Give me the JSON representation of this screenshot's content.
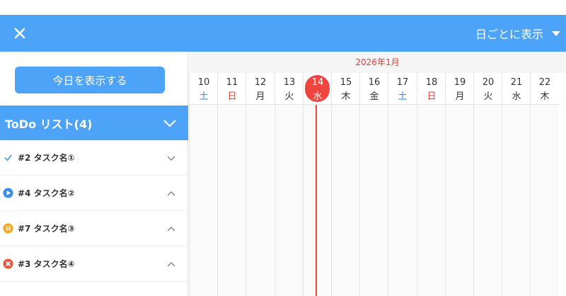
{
  "header": {
    "view_mode": "日ごとに表示"
  },
  "sidebar": {
    "today_button": "今日を表示する",
    "todo_title": "ToDo リスト(4)",
    "items": [
      {
        "name": "#2 タスク名①",
        "status": "check-icon",
        "expanded": false
      },
      {
        "name": "#4 タスク名②",
        "status": "play-icon",
        "expanded": true
      },
      {
        "name": "#7 タスク名③",
        "status": "pause-icon",
        "expanded": true
      },
      {
        "name": "#3 タスク名④",
        "status": "cancel-icon",
        "expanded": true
      }
    ]
  },
  "calendar": {
    "month": "2026年1月",
    "days": [
      {
        "day": "10",
        "weekday": "土",
        "type": "sat"
      },
      {
        "day": "11",
        "weekday": "日",
        "type": "sun"
      },
      {
        "day": "12",
        "weekday": "月",
        "type": "weekday"
      },
      {
        "day": "13",
        "weekday": "火",
        "type": "weekday"
      },
      {
        "day": "14",
        "weekday": "水",
        "type": "today"
      },
      {
        "day": "15",
        "weekday": "木",
        "type": "weekday"
      },
      {
        "day": "16",
        "weekday": "金",
        "type": "weekday"
      },
      {
        "day": "17",
        "weekday": "土",
        "type": "sat"
      },
      {
        "day": "18",
        "weekday": "日",
        "type": "sun"
      },
      {
        "day": "19",
        "weekday": "月",
        "type": "weekday"
      },
      {
        "day": "20",
        "weekday": "火",
        "type": "weekday"
      },
      {
        "day": "21",
        "weekday": "水",
        "type": "weekday"
      },
      {
        "day": "22",
        "weekday": "木",
        "type": "weekday"
      }
    ]
  },
  "colors": {
    "primary": "#4da3f7",
    "today": "#f0443f",
    "saturday": "#2b8ee6",
    "sunday": "#e53935"
  }
}
